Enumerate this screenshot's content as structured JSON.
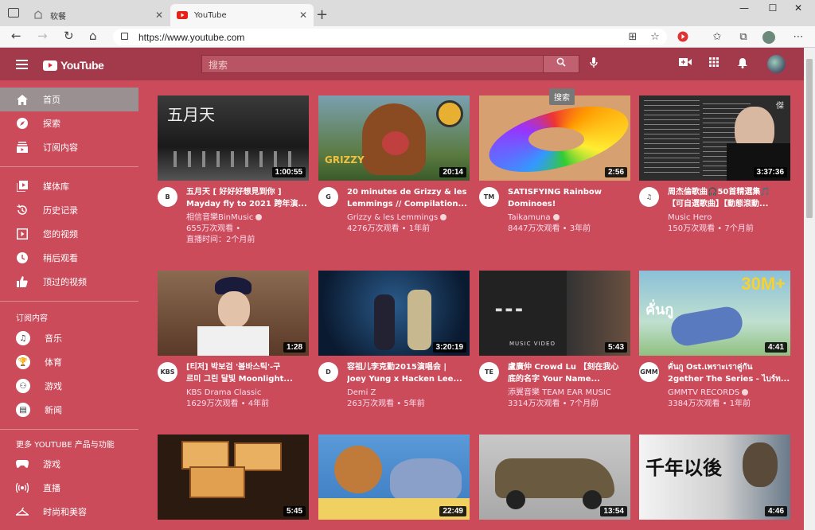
{
  "browser": {
    "tabs": [
      {
        "label": "软餐",
        "active": false
      },
      {
        "label": "YouTube",
        "active": true
      }
    ],
    "url": "https://www.youtube.com"
  },
  "header": {
    "logo_text": "YouTube",
    "search_placeholder": "搜索",
    "tooltip": "搜索"
  },
  "sidebar": {
    "main": [
      {
        "label": "首页",
        "icon": "home-icon",
        "selected": true
      },
      {
        "label": "探索",
        "icon": "compass-icon"
      },
      {
        "label": "订阅内容",
        "icon": "subscriptions-icon"
      }
    ],
    "library": [
      {
        "label": "媒体库",
        "icon": "library-icon"
      },
      {
        "label": "历史记录",
        "icon": "history-icon"
      },
      {
        "label": "您的视频",
        "icon": "your-videos-icon"
      },
      {
        "label": "稍后观看",
        "icon": "watch-later-icon"
      },
      {
        "label": "顶过的视频",
        "icon": "thumbs-up-icon"
      }
    ],
    "subs_heading": "订阅内容",
    "subs": [
      {
        "label": "音乐",
        "icon": "music-note-icon"
      },
      {
        "label": "体育",
        "icon": "trophy-icon"
      },
      {
        "label": "游戏",
        "icon": "gamepad-icon"
      },
      {
        "label": "新闻",
        "icon": "newspaper-icon"
      }
    ],
    "more_heading": "更多 YOUTUBE 产品与功能",
    "more": [
      {
        "label": "游戏",
        "icon": "gaming-icon"
      },
      {
        "label": "直播",
        "icon": "live-icon"
      },
      {
        "label": "时尚和美容",
        "icon": "hanger-icon"
      }
    ]
  },
  "videos": [
    {
      "title1": "五月天 [ 好好好想見到你 ]",
      "title2": "Mayday fly to 2021 跨年演...",
      "channel": "相信音樂BinMusic",
      "verified": true,
      "views": "655万次观看 •",
      "when": "直播时间：2个月前",
      "duration": "1:00:55",
      "avatar": "B",
      "thumb": "#2a2a2a"
    },
    {
      "title1": "20 minutes de Grizzy & les",
      "title2": "Lemmings // Compilation...",
      "channel": "Grizzy & les Lemmings",
      "verified": true,
      "views": "4276万次观看 • 1年前",
      "when": "",
      "duration": "20:14",
      "avatar": "G",
      "thumb": "#6b8a3a"
    },
    {
      "title1": "SATISFYING Rainbow",
      "title2": "Dominoes!",
      "channel": "Taikamuna",
      "verified": true,
      "views": "8447万次观看 • 3年前",
      "when": "",
      "duration": "2:56",
      "avatar": "TM",
      "thumb": "#c98a4a"
    },
    {
      "title1": "周杰倫歌曲🎧50首精選集🎵",
      "title2": "【可自選歌曲】【動態滾動...",
      "channel": "Music Hero",
      "verified": false,
      "views": "150万次观看 • 7个月前",
      "when": "",
      "duration": "3:37:36",
      "avatar": "♫",
      "thumb": "#3a3a3a"
    },
    {
      "title1": "[티저] 박보검 '봄바스틱'-구",
      "title2": "르미 그린 달빛 Moonlight...",
      "channel": "KBS Drama Classic",
      "verified": false,
      "views": "1629万次观看 • 4年前",
      "when": "",
      "duration": "1:28",
      "avatar": "KBS",
      "thumb": "#6d4a38"
    },
    {
      "title1": "容祖儿李克勤2015演唱会 |",
      "title2": "Joey Yung x Hacken Lee...",
      "channel": "Demi Z",
      "verified": false,
      "views": "263万次观看 • 5年前",
      "when": "",
      "duration": "3:20:19",
      "avatar": "D",
      "thumb": "#1e3a5a"
    },
    {
      "title1": "盧廣仲 Crowd Lu 【刻在我心",
      "title2": "底的名字 Your Name...",
      "channel": "添翼音樂 TEAM EAR MUSIC",
      "verified": false,
      "views": "3314万次观看 • 7个月前",
      "when": "",
      "duration": "5:43",
      "avatar": "TE",
      "thumb": "#2a2a2a"
    },
    {
      "title1": "คั่นกู Ost.เพราะเราคู่กัน",
      "title2": "2gether The Series - ไบร์ท...",
      "channel": "GMMTV RECORDS",
      "verified": true,
      "views": "3384万次观看 • 1年前",
      "when": "",
      "duration": "4:41",
      "avatar": "GMM",
      "thumb": "#8ab4c8"
    },
    {
      "title1": "",
      "title2": "",
      "channel": "",
      "verified": false,
      "views": "",
      "when": "",
      "duration": "5:45",
      "avatar": "",
      "thumb": "#4a3020"
    },
    {
      "title1": "",
      "title2": "",
      "channel": "",
      "verified": false,
      "views": "",
      "when": "",
      "duration": "22:49",
      "avatar": "",
      "thumb": "#3a7ac0"
    },
    {
      "title1": "",
      "title2": "",
      "channel": "",
      "verified": false,
      "views": "",
      "when": "",
      "duration": "13:54",
      "avatar": "",
      "thumb": "#6a5a40"
    },
    {
      "title1": "",
      "title2": "",
      "channel": "",
      "verified": false,
      "views": "",
      "when": "",
      "duration": "4:46",
      "avatar": "",
      "thumb": "#d8d8d8"
    }
  ],
  "thumb_text": {
    "mayday": "五月天",
    "grizzy": "GRIZZY",
    "jay_mark": "傑",
    "music_video": "MUSIC VIDEO",
    "thai_big": "30M+",
    "thai_title": "คั่นกู",
    "chinese_song": "千年以後"
  }
}
